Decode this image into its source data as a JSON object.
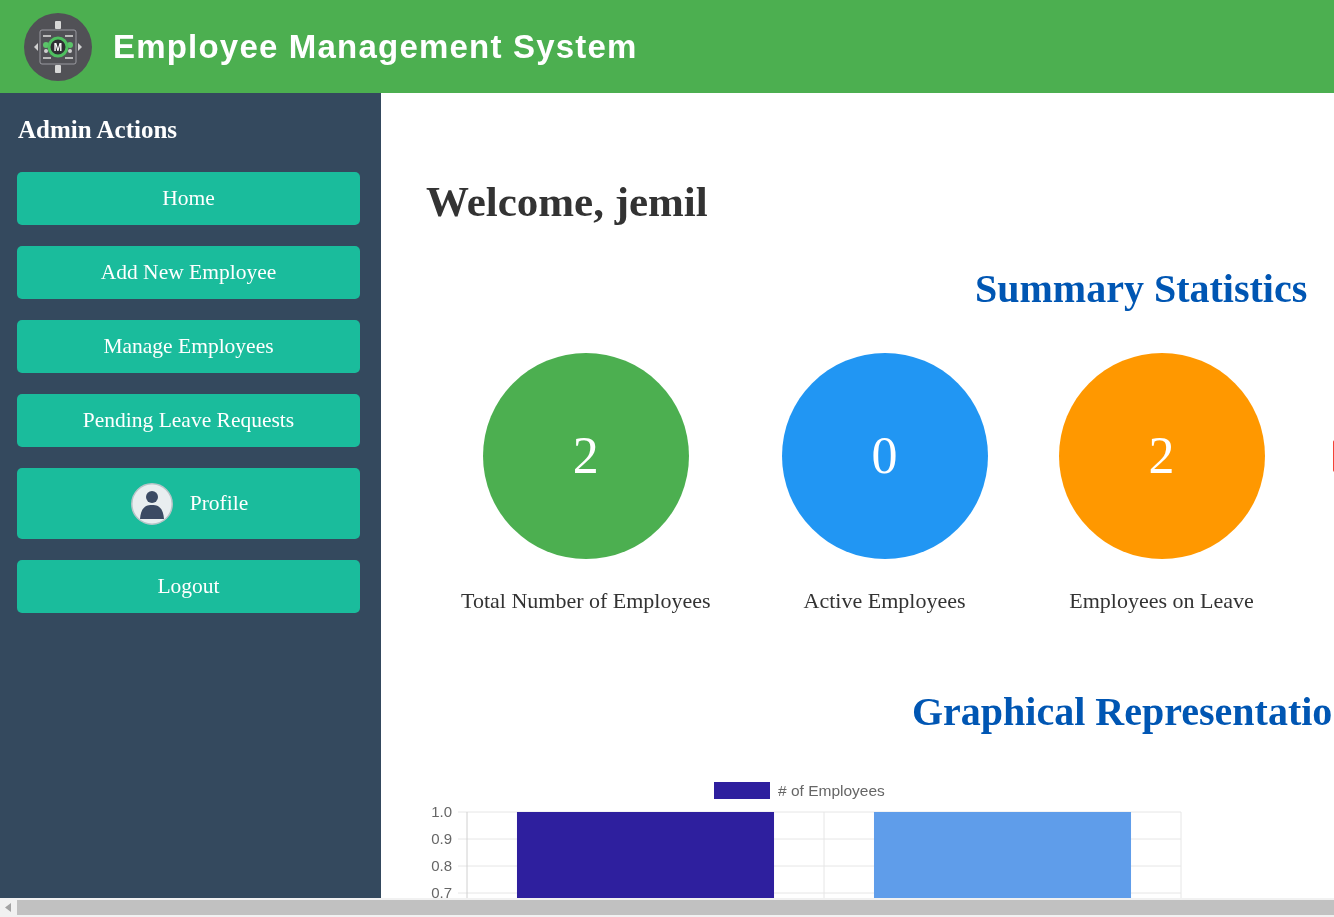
{
  "header": {
    "logo_letter": "M",
    "title": "Employee Management System"
  },
  "sidebar": {
    "title": "Admin Actions",
    "items": [
      {
        "label": "Home",
        "kind": "link"
      },
      {
        "label": "Add New Employee",
        "kind": "link"
      },
      {
        "label": "Manage Employees",
        "kind": "link"
      },
      {
        "label": "Pending Leave Requests",
        "kind": "link"
      },
      {
        "label": "Profile",
        "kind": "profile"
      },
      {
        "label": "Logout",
        "kind": "link"
      }
    ]
  },
  "main": {
    "welcome": "Welcome, jemil",
    "summary_title": "Summary Statistics",
    "stats": [
      {
        "value": "2",
        "label": "Total Number of Employees",
        "color": "#4caf50"
      },
      {
        "value": "0",
        "label": "Active Employees",
        "color": "#2196f3"
      },
      {
        "value": "2",
        "label": "Employees on Leave",
        "color": "#ff9800"
      },
      {
        "color": "#f44336"
      }
    ],
    "graph_title": "Graphical Representatio",
    "chart_data": {
      "type": "bar",
      "stacked": true,
      "series": [
        {
          "name": "# of Employees",
          "color": "#2e1f9e",
          "values": [
            1,
            null
          ]
        },
        {
          "color": "#5f9dea",
          "values": [
            null,
            1
          ]
        }
      ],
      "ylim": [
        0.7,
        1
      ],
      "yticks": [
        {
          "value": 1,
          "label": "1.0"
        },
        0.9,
        0.8,
        0.7
      ]
    }
  }
}
